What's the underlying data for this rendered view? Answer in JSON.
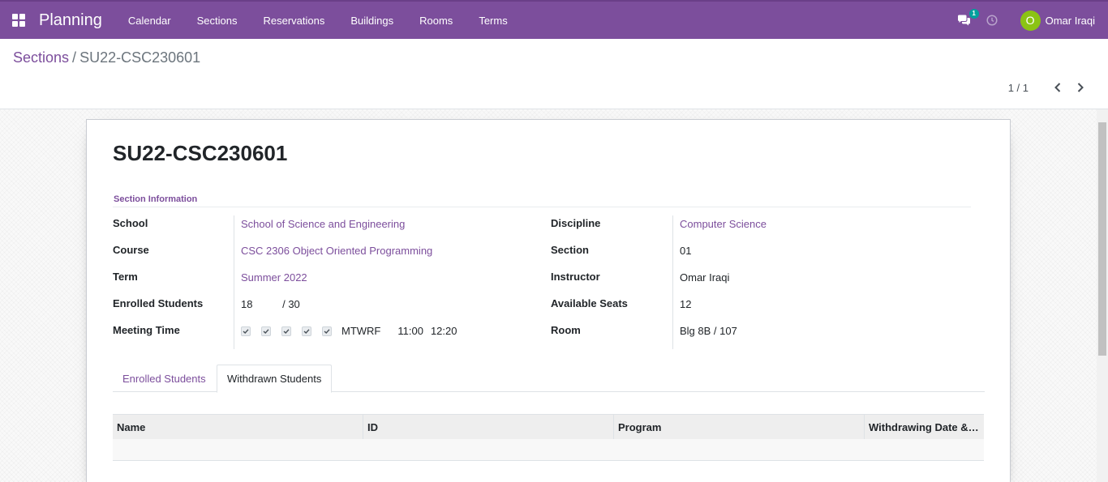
{
  "navbar": {
    "app_name": "Planning",
    "menu": [
      "Calendar",
      "Sections",
      "Reservations",
      "Buildings",
      "Rooms",
      "Terms"
    ],
    "messages_count": "1",
    "user_initial": "O",
    "user_name": "Omar Iraqi",
    "brand_color": "#7c4e9c",
    "avatar_color": "#8bc314"
  },
  "breadcrumb": {
    "parent": "Sections",
    "separator": "/",
    "current": "SU22-CSC230601"
  },
  "pager": {
    "value": "1 / 1"
  },
  "record": {
    "title": "SU22-CSC230601",
    "group_title": "Section Information",
    "left_fields": [
      {
        "label": "School",
        "value": "School of Science and Engineering"
      },
      {
        "label": "Course",
        "value": "CSC 2306 Object Oriented Programming"
      },
      {
        "label": "Term",
        "value": "Summer 2022"
      },
      {
        "label": "Enrolled Students",
        "value": "18",
        "capacity": "/ 30"
      },
      {
        "label": "Meeting Time",
        "days": "MTWRF",
        "start": "11:00",
        "end": "12:20",
        "day_checks": [
          true,
          true,
          true,
          true,
          true
        ]
      }
    ],
    "right_fields": [
      {
        "label": "Discipline",
        "value": "Computer Science"
      },
      {
        "label": "Section",
        "value": "01"
      },
      {
        "label": "Instructor",
        "value": "Omar Iraqi"
      },
      {
        "label": "Available Seats",
        "value": "12"
      },
      {
        "label": "Room",
        "value": "Blg 8B / 107"
      }
    ]
  },
  "tabs": [
    {
      "label": "Enrolled Students",
      "active": false
    },
    {
      "label": "Withdrawn Students",
      "active": true
    }
  ],
  "table": {
    "columns": [
      "Name",
      "ID",
      "Program",
      "Withdrawing Date &…"
    ],
    "rows": []
  }
}
